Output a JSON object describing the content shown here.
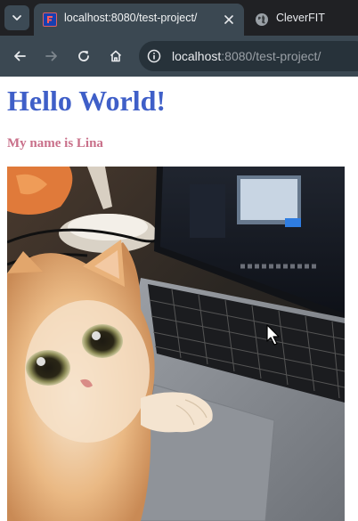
{
  "browser": {
    "tabs": [
      {
        "title": "localhost:8080/test-project/",
        "active": true,
        "favicon": "app-icon"
      },
      {
        "title": "CleverFIT",
        "active": false,
        "favicon": "globe-icon"
      }
    ],
    "address": {
      "host": "localhost",
      "path": ":8080/test-project/"
    },
    "toolbar": {
      "buttons": [
        "back-icon",
        "forward-icon",
        "reload-icon",
        "home-icon"
      ]
    }
  },
  "page": {
    "heading": "Hello World!",
    "subheading": "My name is Lina",
    "image": {
      "alt": "cat with paw on laptop keyboard"
    }
  },
  "colors": {
    "tabstrip": "#202124",
    "toolbar": "#3b4852",
    "heading": "#3f5fc8",
    "subheading": "#c9708a"
  }
}
